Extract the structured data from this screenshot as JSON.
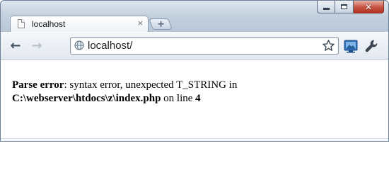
{
  "window": {
    "controls": {
      "minimize": "minimize",
      "maximize": "maximize",
      "close": "✕"
    }
  },
  "tab": {
    "title": "localhost",
    "close_glyph": "×",
    "favicon": "page-icon"
  },
  "new_tab": {
    "glyph": "+"
  },
  "toolbar": {
    "back_glyph": "←",
    "forward_glyph": "→",
    "address": "localhost/",
    "address_icon": "globe-icon",
    "bookmark_icon": "star-icon",
    "page_action_icon": "screen-capture-icon",
    "menu_icon": "wrench-icon"
  },
  "page": {
    "error_label": "Parse error",
    "error_message": ": syntax error, unexpected T_STRING in",
    "file_path": "C:\\webserver\\htdocs\\z\\index.php",
    "on_line_text": " on line ",
    "line_number": "4"
  },
  "colors": {
    "frame": "#b8c7d7",
    "close_button": "#c9594a",
    "page_background": "#ffffff"
  }
}
